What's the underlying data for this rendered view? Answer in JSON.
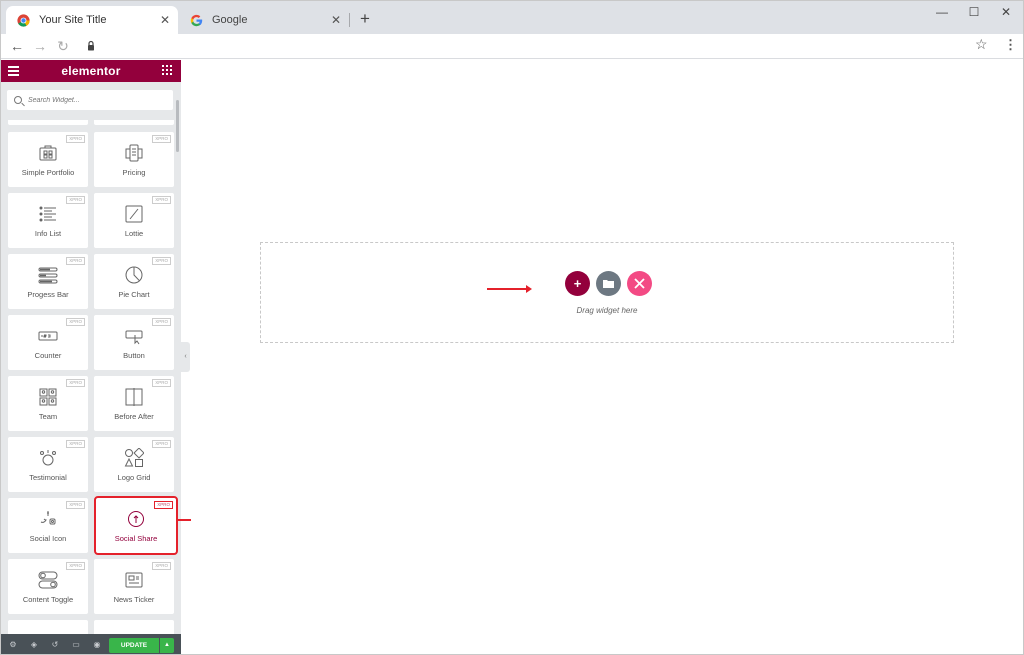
{
  "browser": {
    "tabs": [
      {
        "title": "Your Site Title",
        "active": true
      },
      {
        "title": "Google",
        "active": false
      }
    ],
    "close_glyph": "✕",
    "new_tab_glyph": "+",
    "window_controls": {
      "minimize": "—",
      "maximize": "☐",
      "close": "✕"
    },
    "nav": {
      "back": "←",
      "forward": "→",
      "reload": "↻"
    },
    "star": "☆",
    "menu": "⋮"
  },
  "panel": {
    "brand": "elementor",
    "search_placeholder": "Search Widget...",
    "widgets": [
      {
        "label": "Simple Portfolio",
        "badge": "XPRO",
        "icon": "portfolio-icon"
      },
      {
        "label": "Pricing",
        "badge": "XPRO",
        "icon": "pricing-icon"
      },
      {
        "label": "Info List",
        "badge": "XPRO",
        "icon": "info-list-icon"
      },
      {
        "label": "Lottie",
        "badge": "XPRO",
        "icon": "lottie-icon"
      },
      {
        "label": "Progess Bar",
        "badge": "XPRO",
        "icon": "progress-bar-icon"
      },
      {
        "label": "Pie Chart",
        "badge": "XPRO",
        "icon": "pie-chart-icon"
      },
      {
        "label": "Counter",
        "badge": "XPRO",
        "icon": "counter-icon"
      },
      {
        "label": "Button",
        "badge": "XPRO",
        "icon": "button-icon"
      },
      {
        "label": "Team",
        "badge": "XPRO",
        "icon": "team-icon"
      },
      {
        "label": "Before After",
        "badge": "XPRO",
        "icon": "before-after-icon"
      },
      {
        "label": "Testimonial",
        "badge": "XPRO",
        "icon": "testimonial-icon"
      },
      {
        "label": "Logo Grid",
        "badge": "XPRO",
        "icon": "logo-grid-icon"
      },
      {
        "label": "Social Icon",
        "badge": "XPRO",
        "icon": "social-icon-icon"
      },
      {
        "label": "Social Share",
        "badge": "XPRO",
        "icon": "social-share-icon",
        "highlighted": true
      },
      {
        "label": "Content Toggle",
        "badge": "XPRO",
        "icon": "content-toggle-icon"
      },
      {
        "label": "News Ticker",
        "badge": "XPRO",
        "icon": "news-ticker-icon"
      }
    ],
    "collapse_glyph": "‹",
    "footer": {
      "update_label": "UPDATE",
      "more_glyph": "▲"
    }
  },
  "canvas": {
    "drag_text": "Drag widget here",
    "add_glyph": "+",
    "colors": {
      "add": "#93003c",
      "folder": "#6d7882",
      "kit": "#f34a84",
      "arrow": "#e4212b"
    }
  }
}
